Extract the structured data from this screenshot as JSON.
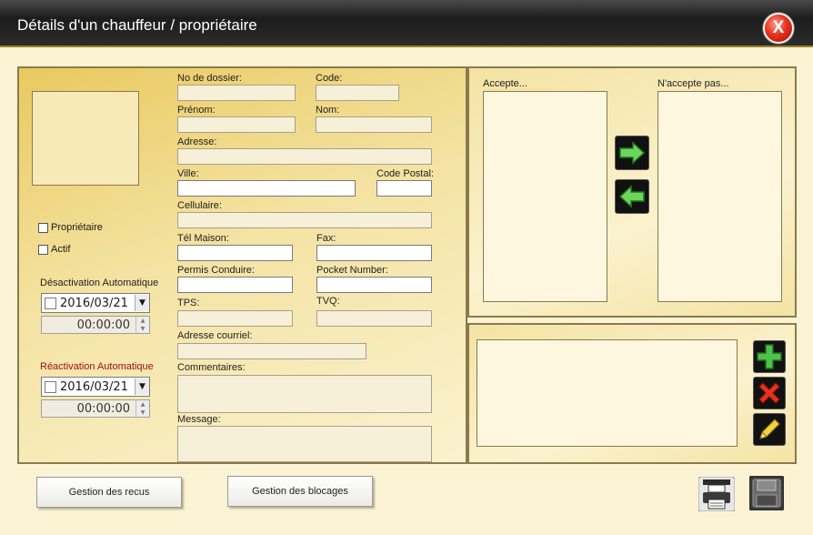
{
  "window": {
    "title": "Détails d'un chauffeur / propriétaire",
    "close_label": "X"
  },
  "left": {
    "checkboxes": {
      "proprietaire": "Propriétaire",
      "actif": "Actif"
    },
    "deactivation": {
      "label": "Désactivation Automatique",
      "date": "2016/03/21",
      "time": "00:00:00"
    },
    "reactivation": {
      "label": "Réactivation Automatique",
      "date": "2016/03/21",
      "time": "00:00:00",
      "label_color": "#a01010"
    }
  },
  "form": {
    "no_dossier": {
      "label": "No de dossier:",
      "value": ""
    },
    "code": {
      "label": "Code:",
      "value": ""
    },
    "prenom": {
      "label": "Prénom:",
      "value": ""
    },
    "nom": {
      "label": "Nom:",
      "value": ""
    },
    "adresse": {
      "label": "Adresse:",
      "value": ""
    },
    "ville": {
      "label": "Ville:",
      "value": ""
    },
    "code_postal": {
      "label": "Code Postal:",
      "value": ""
    },
    "cellulaire": {
      "label": "Cellulaire:",
      "value": ""
    },
    "tel_maison": {
      "label": "Tél Maison:",
      "value": ""
    },
    "fax": {
      "label": "Fax:",
      "value": ""
    },
    "permis": {
      "label": "Permis Conduire:",
      "value": ""
    },
    "pocket": {
      "label": "Pocket Number:",
      "value": ""
    },
    "tps": {
      "label": "TPS:",
      "value": ""
    },
    "tvq": {
      "label": "TVQ:",
      "value": ""
    },
    "courriel": {
      "label": "Adresse courriel:",
      "value": ""
    },
    "commentaires": {
      "label": "Commentaires:",
      "value": ""
    },
    "message": {
      "label": "Message:",
      "value": ""
    }
  },
  "lists": {
    "accepte": "Accepte...",
    "n_accepte_pas": "N'accepte pas..."
  },
  "buttons": {
    "gestion_recus": "Gestion des recus",
    "gestion_blocages": "Gestion des blocages"
  },
  "colors": {
    "accent": "#e9c95f",
    "title_bar": "#1c1c1c",
    "close": "#e8321e"
  },
  "icons": {
    "move_right": "arrow-right-icon",
    "move_left": "arrow-left-icon",
    "add": "plus-icon",
    "delete": "x-icon",
    "edit": "pencil-icon",
    "print": "printer-icon",
    "save": "floppy-icon"
  }
}
